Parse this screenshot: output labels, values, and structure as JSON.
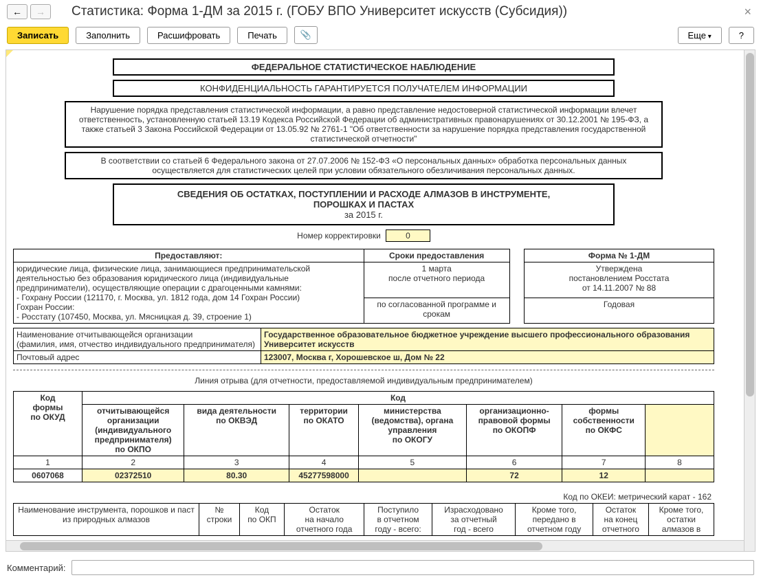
{
  "header": {
    "title": "Статистика: Форма 1-ДМ за 2015 г. (ГОБУ ВПО Университет искусств (Субсидия))"
  },
  "toolbar": {
    "save": "Записать",
    "fill": "Заполнить",
    "decode": "Расшифровать",
    "print": "Печать",
    "more": "Еще",
    "help": "?"
  },
  "document": {
    "box1": "ФЕДЕРАЛЬНОЕ СТАТИСТИЧЕСКОЕ НАБЛЮДЕНИЕ",
    "box2": "КОНФИДЕНЦИАЛЬНОСТЬ ГАРАНТИРУЕТСЯ ПОЛУЧАТЕЛЕМ ИНФОРМАЦИИ",
    "box3": "Нарушение порядка представления статистической информации, а равно представление недостоверной статистической информации влечет ответственность, установленную статьей 13.19 Кодекса Российской Федерации об административных правонарушениях от 30.12.2001 № 195-ФЗ, а также статьей 3 Закона Российской Федерации от 13.05.92 № 2761-1 \"Об ответственности за нарушение порядка представления государственной статистической отчетности\"",
    "box4": "В соответствии со статьей 6 Федерального закона от 27.07.2006 № 152-ФЗ «О персональных данных» обработка персональных данных осуществляется для статистических целей при условии обязательного обезличивания персональных данных.",
    "box5_line1": "СВЕДЕНИЯ ОБ ОСТАТКАХ, ПОСТУПЛЕНИИ И РАСХОДЕ АЛМАЗОВ В ИНСТРУМЕНТЕ,",
    "box5_line2": "ПОРОШКАХ И ПАСТАХ",
    "box5_line3": "за 2015 г.",
    "correction_label": "Номер корректировки",
    "correction_value": "0",
    "provide": {
      "h1": "Предоставляют:",
      "h2": "Сроки предоставления",
      "h3": "Форма № 1-ДМ",
      "body1": "юридические лица, физические лица, занимающиеся предпринимательской деятельностью без образования юридического лица (индивидуальные предприниматели), осуществляющие операции с драгоценными камнями:\n  - Гохрану России (121170, г. Москва, ул. 1812 года, дом 14 Гохран России)\nГохран России:\n  - Росстату (107450, Москва, ул. Мясницкая д. 39, строение 1)",
      "body2a": "1 марта\nпосле отчетного периода",
      "body2b": "по согласованной программе и срокам",
      "body3": "Утверждена\nпостановлением Росстата\nот 14.11.2007 № 88",
      "body3b": "Годовая"
    },
    "org": {
      "label1": "Наименование отчитывающейся организации\n(фамилия, имя, отчество индивидуального предпринимателя)",
      "val1": "Государственное образовательное бюджетное учреждение высшего профессионального образования  Университет искусств",
      "label2": "Почтовый адрес",
      "val2": "123007, Москва г, Хорошевское ш, Дом № 22"
    },
    "tear": "Линия отрыва (для отчетности, предоставляемой индивидуальным предпринимателем)",
    "codes": {
      "h": [
        "Код\nформы\nпо ОКУД",
        "отчитывающейся\nорганизации\n(индивидуального\nпредпринимателя)\nпо ОКПО",
        "вида деятельности\nпо ОКВЭД",
        "территории\nпо ОКАТО",
        "министерства\n(ведомства), органа\nуправления\nпо ОКОГУ",
        "организационно-\nправовой формы\nпо ОКОПФ",
        "формы\nсобственности\nпо ОКФС",
        ""
      ],
      "kod_header": "Код",
      "nums": [
        "1",
        "2",
        "3",
        "4",
        "5",
        "6",
        "7",
        "8"
      ],
      "vals": [
        "0607068",
        "02372510",
        "80.30",
        "45277598000",
        "",
        "72",
        "12",
        ""
      ]
    },
    "okei": "Код по ОКЕИ: метрический карат - 162",
    "instr_headers": [
      "Наименование инструмента, порошков и паст\nиз природных алмазов",
      "№\nстроки",
      "Код\nпо ОКП",
      "Остаток\nна начало\nотчетного года",
      "Поступило\nв отчетном\nгоду - всего:",
      "Израсходовано\nза отчетный\nгод - всего",
      "Кроме того,\nпередано в\nотчетном году",
      "Остаток\nна конец\nотчетного",
      "Кроме того,\nостатки\nалмазов в"
    ]
  },
  "footer": {
    "comment_label": "Комментарий:"
  }
}
